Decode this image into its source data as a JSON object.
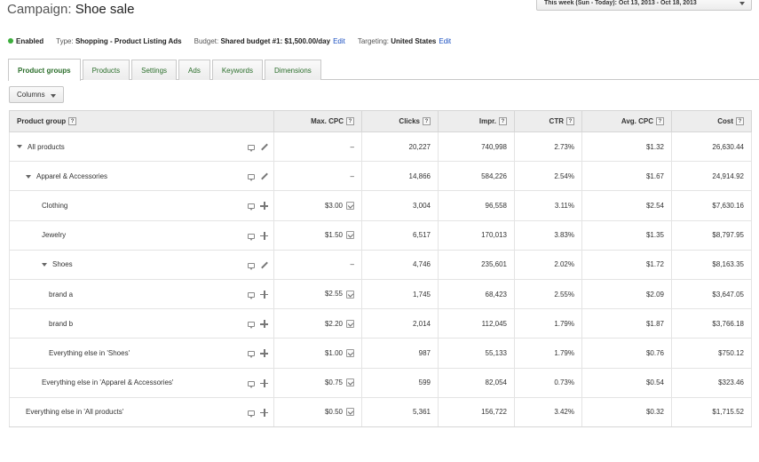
{
  "header": {
    "title_prefix": "Campaign:",
    "title_name": "Shoe sale",
    "date_range": "This week (Sun - Today): Oct 13, 2013 - Oct 18, 2013"
  },
  "status": {
    "state": "Enabled",
    "type_label": "Type:",
    "type_value": "Shopping - Product Listing Ads",
    "budget_label": "Budget:",
    "budget_value": "Shared budget #1: $1,500.00/day",
    "budget_edit": "Edit",
    "targeting_label": "Targeting:",
    "targeting_value": "United States",
    "targeting_edit": "Edit"
  },
  "tabs": [
    {
      "label": "Product groups",
      "active": true
    },
    {
      "label": "Products"
    },
    {
      "label": "Settings"
    },
    {
      "label": "Ads"
    },
    {
      "label": "Keywords"
    },
    {
      "label": "Dimensions"
    }
  ],
  "toolbar": {
    "columns_label": "Columns"
  },
  "table": {
    "headers": [
      "Product group",
      "Max. CPC",
      "Clicks",
      "Impr.",
      "CTR",
      "Avg. CPC",
      "Cost"
    ],
    "help_glyph": "?",
    "rows": [
      {
        "name": "All products",
        "indent": 0,
        "expand": true,
        "action": "edit",
        "max_cpc": "–",
        "bid_icon": false,
        "clicks": "20,227",
        "impr": "740,998",
        "ctr": "2.73%",
        "avg_cpc": "$1.32",
        "cost": "26,630.44"
      },
      {
        "name": "Apparel & Accessories",
        "indent": 1,
        "expand": true,
        "action": "edit",
        "max_cpc": "–",
        "bid_icon": false,
        "clicks": "14,866",
        "impr": "584,226",
        "ctr": "2.54%",
        "avg_cpc": "$1.67",
        "cost": "24,914.92"
      },
      {
        "name": "Clothing",
        "indent": 2,
        "expand": false,
        "action": "add",
        "max_cpc": "$3.00",
        "bid_icon": true,
        "clicks": "3,004",
        "impr": "96,558",
        "ctr": "3.11%",
        "avg_cpc": "$2.54",
        "cost": "$7,630.16"
      },
      {
        "name": "Jewelry",
        "indent": 2,
        "expand": false,
        "action": "add",
        "max_cpc": "$1.50",
        "bid_icon": true,
        "clicks": "6,517",
        "impr": "170,013",
        "ctr": "3.83%",
        "avg_cpc": "$1.35",
        "cost": "$8,797.95"
      },
      {
        "name": "Shoes",
        "indent": 2,
        "expand": true,
        "action": "edit",
        "max_cpc": "–",
        "bid_icon": false,
        "clicks": "4,746",
        "impr": "235,601",
        "ctr": "2.02%",
        "avg_cpc": "$1.72",
        "cost": "$8,163.35"
      },
      {
        "name": "brand a",
        "indent": 3,
        "expand": false,
        "action": "add",
        "max_cpc": "$2.55",
        "bid_icon": true,
        "clicks": "1,745",
        "impr": "68,423",
        "ctr": "2.55%",
        "avg_cpc": "$2.09",
        "cost": "$3,647.05"
      },
      {
        "name": "brand b",
        "indent": 3,
        "expand": false,
        "action": "add",
        "max_cpc": "$2.20",
        "bid_icon": true,
        "clicks": "2,014",
        "impr": "112,045",
        "ctr": "1.79%",
        "avg_cpc": "$1.87",
        "cost": "$3,766.18"
      },
      {
        "name": "Everything else in 'Shoes'",
        "indent": 3,
        "expand": false,
        "action": "add",
        "max_cpc": "$1.00",
        "bid_icon": true,
        "clicks": "987",
        "impr": "55,133",
        "ctr": "1.79%",
        "avg_cpc": "$0.76",
        "cost": "$750.12"
      },
      {
        "name": "Everything else in 'Apparel & Accessories'",
        "indent": 2,
        "expand": false,
        "action": "add",
        "max_cpc": "$0.75",
        "bid_icon": true,
        "clicks": "599",
        "impr": "82,054",
        "ctr": "0.73%",
        "avg_cpc": "$0.54",
        "cost": "$323.46"
      },
      {
        "name": "Everything else in 'All products'",
        "indent": 1,
        "expand": false,
        "action": "add",
        "max_cpc": "$0.50",
        "bid_icon": true,
        "clicks": "5,361",
        "impr": "156,722",
        "ctr": "3.42%",
        "avg_cpc": "$0.32",
        "cost": "$1,715.52"
      }
    ]
  },
  "colors": {
    "accent": "#2b6e2b",
    "link": "#1a4fc0",
    "enabled": "#3cae3c"
  }
}
